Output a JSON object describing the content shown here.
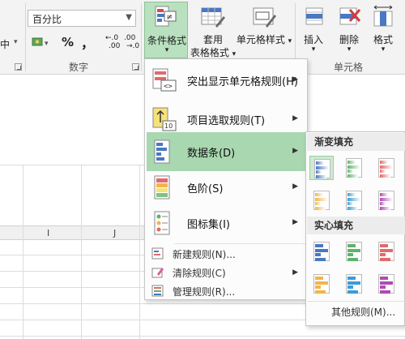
{
  "ribbon": {
    "left_partial": "中",
    "number_format": "百分比",
    "percent_symbol": "%",
    "comma_symbol": "，",
    "dec_increase": ".00",
    "dec_increase_prefix": "←.0",
    "dec_decrease": "→.0",
    "dec_decrease_prefix": ".00",
    "number_group": "数字",
    "cond_format": "条件格式",
    "table_format_line1": "套用",
    "table_format_line2": "表格格式",
    "cell_styles": "单元格样式",
    "insert": "插入",
    "delete": "删除",
    "format": "格式",
    "cells_group": "单元格"
  },
  "sheet": {
    "col_i": "I",
    "col_j": "J"
  },
  "menu": {
    "highlight_rules": "突出显示单元格规则(H)",
    "top_bottom_rules": "项目选取规则(T)",
    "data_bars": "数据条(D)",
    "color_scales": "色阶(S)",
    "icon_sets": "图标集(I)",
    "new_rule": "新建规则(N)...",
    "clear_rules": "清除规则(C)",
    "manage_rules": "管理规则(R)...",
    "icon_ten": "10"
  },
  "submenu": {
    "gradient_fill": "渐变填充",
    "solid_fill": "实心填充",
    "more_rules": "其他规则(M)...",
    "colors": [
      "#4a78c2",
      "#5fb36b",
      "#e26a6a",
      "#f2b54a",
      "#3e9ad6",
      "#b04ab2"
    ]
  }
}
